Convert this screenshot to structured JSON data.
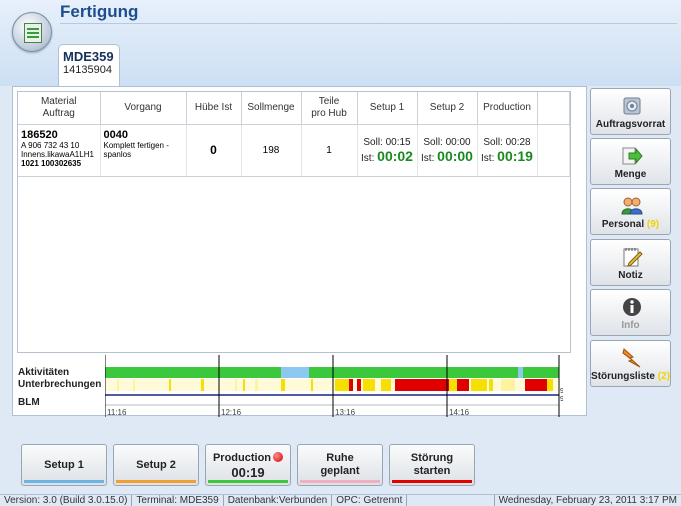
{
  "app": {
    "title": "Fertigung",
    "icon": "production-list-icon"
  },
  "machine": {
    "name": "MDE359",
    "id": "14135904"
  },
  "table": {
    "headers": {
      "material": [
        "Material",
        "Auftrag"
      ],
      "vorgang": "Vorgang",
      "huebe_ist": "Hübe Ist",
      "sollmenge": "Sollmenge",
      "teile": [
        "Teile",
        "pro Hub"
      ],
      "setup1": "Setup 1",
      "setup2": "Setup 2",
      "production": "Production"
    },
    "rows": [
      {
        "material": "186520",
        "material_desc": "A 906 732 43 10",
        "material_desc2": "Innens.likawaA1LH1",
        "auftrag": "1021 100302635",
        "vorgang": "0040",
        "vorgang_desc": "Komplett fertigen - spanlos",
        "huebe_ist": "0",
        "sollmenge": "198",
        "teile": "1",
        "setup1_soll": "Soll: 00:15",
        "setup1_ist_label": "Ist:",
        "setup1_ist": "00:02",
        "setup2_soll": "Soll: 00:00",
        "setup2_ist_label": "Ist:",
        "setup2_ist": "00:00",
        "production_soll": "Soll: 00:28",
        "production_ist_label": "Ist:",
        "production_ist": "00:19"
      }
    ]
  },
  "timeline": {
    "labels": {
      "aktivitaeten": "Aktivitäten",
      "unterbrechungen": "Unterbrechungen",
      "blm": "BLM"
    },
    "ticks": [
      "11:16",
      "12:16",
      "13:16",
      "14:16"
    ],
    "blm_value_top": "9",
    "blm_value_bottom": "9",
    "colors": {
      "activity": "#3cc83c",
      "idle": "#8cc8f0",
      "interrupt_yellow": "#f5e000",
      "interrupt_light": "#fff8a8",
      "interrupt_red": "#e00000",
      "blm_line": "#1a237e"
    }
  },
  "side_buttons": [
    {
      "label": "Auftragsvorrat",
      "count": "",
      "icon": "gear-icon"
    },
    {
      "label": "Menge",
      "count": "",
      "icon": "arrow-right-icon"
    },
    {
      "label": "Personal",
      "count": "(9)",
      "icon": "people-icon"
    },
    {
      "label": "Notiz",
      "count": "",
      "icon": "notepad-icon"
    },
    {
      "label": "Info",
      "count": "",
      "icon": "info-icon"
    },
    {
      "label": "Störungsliste",
      "count": "(2)",
      "icon": "lightning-icon"
    }
  ],
  "bottom_buttons": [
    {
      "label": "Setup 1",
      "color": "#6cb4e6"
    },
    {
      "label": "Setup 2",
      "color": "#f0a030"
    },
    {
      "label": "Production",
      "timer": "00:19",
      "color": "#3cc83c"
    },
    {
      "label_line1": "Ruhe",
      "label_line2": "geplant",
      "color": "#f0b0c0"
    },
    {
      "label_line1": "Störung",
      "label_line2": "starten",
      "color": "#e00000"
    }
  ],
  "status": {
    "version": "Version: 3.0 (Build 3.0.15.0)",
    "terminal": "Terminal: MDE359",
    "db": "Datenbank:Verbunden",
    "opc": "OPC: Getrennt",
    "date": "Wednesday, February 23, 2011 3:17 PM"
  }
}
